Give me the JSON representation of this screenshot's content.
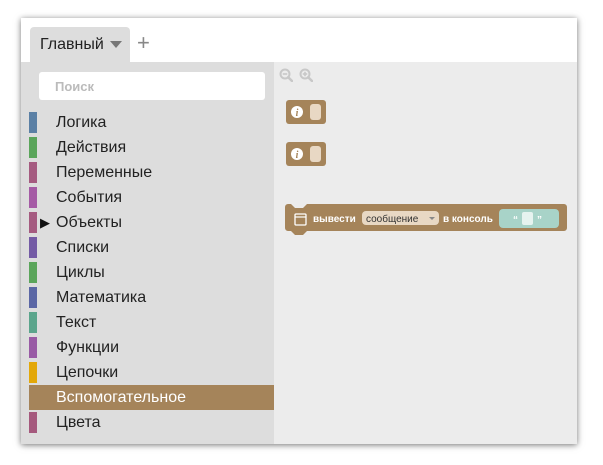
{
  "tabs": [
    {
      "label": "Главный"
    }
  ],
  "search": {
    "placeholder": "Поиск"
  },
  "categories": [
    {
      "label": "Логика",
      "color": "#5b80a5"
    },
    {
      "label": "Действия",
      "color": "#5ba55b"
    },
    {
      "label": "Переменные",
      "color": "#a55b80"
    },
    {
      "label": "События",
      "color": "#a55ba5"
    },
    {
      "label": "Объекты",
      "color": "#a55b80",
      "expandable": true
    },
    {
      "label": "Списки",
      "color": "#745ba5"
    },
    {
      "label": "Циклы",
      "color": "#5ba55b"
    },
    {
      "label": "Математика",
      "color": "#5b67a5"
    },
    {
      "label": "Текст",
      "color": "#5ba58c"
    },
    {
      "label": "Функции",
      "color": "#995ba5"
    },
    {
      "label": "Цепочки",
      "color": "#e3a80a"
    },
    {
      "label": "Вспомогательное",
      "color": "#a5845a",
      "selected": true
    },
    {
      "label": "Цвета",
      "color": "#a5597d"
    }
  ],
  "workspace": {
    "zoom_out_icon": "zoom-out-icon",
    "zoom_in_icon": "zoom-in-icon",
    "blocks": {
      "log": {
        "text_before": "вывести",
        "dropdown": "сообщение",
        "text_after": "в консоль",
        "quote_open": "“",
        "quote_close": "”"
      }
    },
    "block_color": "#a5845a",
    "text_block_color": "#a8d3c8"
  }
}
